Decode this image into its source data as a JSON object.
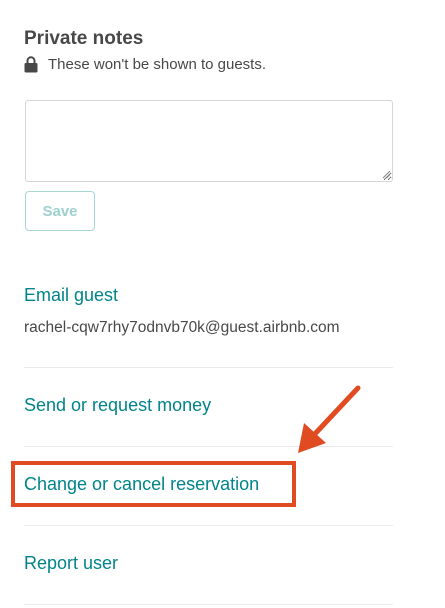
{
  "private_notes": {
    "title": "Private notes",
    "subtitle": "These won't be shown to guests.",
    "textarea_value": "",
    "save_label": "Save"
  },
  "email_guest": {
    "label": "Email guest",
    "address": "rachel-cqw7rhy7odnvb70k@guest.airbnb.com"
  },
  "actions": {
    "send_money": "Send or request money",
    "change_cancel": "Change or cancel reservation",
    "report_user": "Report user"
  },
  "colors": {
    "link": "#008489",
    "annotation": "#e04b22"
  },
  "annotation": {
    "highlight_target": "Change or cancel reservation",
    "arrow": "arrow-pointing-down-left"
  }
}
